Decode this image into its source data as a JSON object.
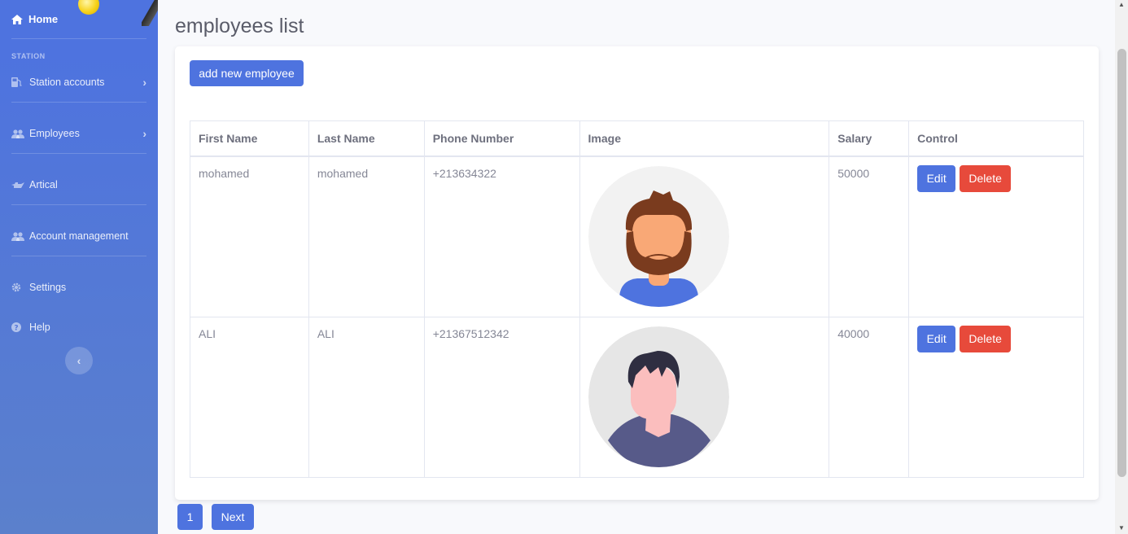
{
  "sidebar": {
    "home_label": "Home",
    "section_heading": "STATION",
    "items": [
      {
        "label": "Station accounts",
        "icon": "gas-pump-icon",
        "has_chevron": true
      },
      {
        "label": "Employees",
        "icon": "users-icon",
        "has_chevron": true
      },
      {
        "label": "Artical",
        "icon": "oil-can-icon",
        "has_chevron": false
      },
      {
        "label": "Account management",
        "icon": "users-icon",
        "has_chevron": false
      },
      {
        "label": "Settings",
        "icon": "gear-icon",
        "has_chevron": false
      },
      {
        "label": "Help",
        "icon": "question-circle-icon",
        "has_chevron": false
      }
    ],
    "toggle_symbol": "‹"
  },
  "main": {
    "title": "employees list",
    "add_button_label": "add new employee",
    "table": {
      "headers": [
        "First Name",
        "Last Name",
        "Phone Number",
        "Image",
        "Salary",
        "Control"
      ],
      "rows": [
        {
          "first_name": "mohamed",
          "last_name": "mohamed",
          "phone": "+213634322",
          "avatar": "bearded-man-avatar",
          "salary": "50000"
        },
        {
          "first_name": "ALI",
          "last_name": "ALI",
          "phone": "+21367512342",
          "avatar": "dark-haired-person-avatar",
          "salary": "40000"
        }
      ],
      "edit_label": "Edit",
      "delete_label": "Delete"
    },
    "pagination": {
      "current_page": "1",
      "next_label": "Next"
    }
  },
  "colors": {
    "primary": "#4e73df",
    "danger": "#e74a3b",
    "text_muted": "#858796",
    "background": "#f8f9fc"
  }
}
